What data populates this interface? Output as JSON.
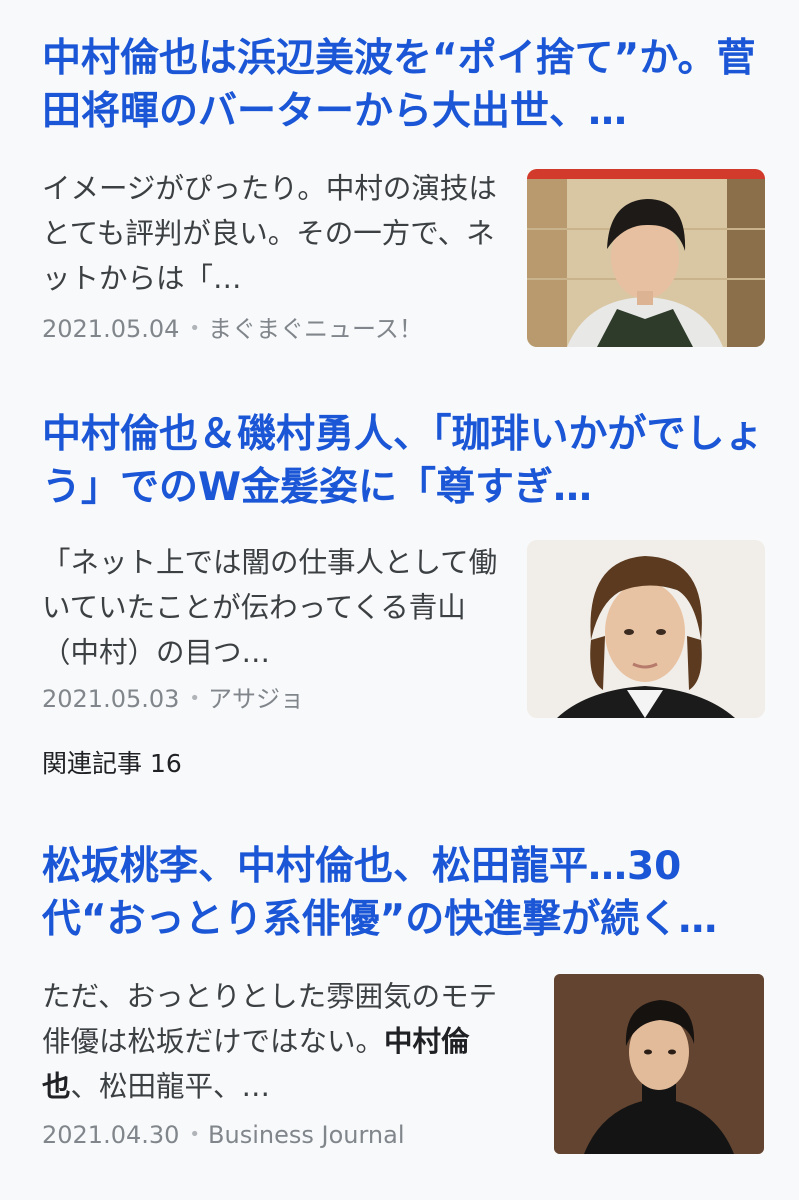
{
  "articles": [
    {
      "headline": "中村倫也は浜辺美波を“ポイ捨て”か。菅田将暉のバーターから大出世、…",
      "snippet": "イメージがぴったり。中村の演技はとても評判が良い。その一方で、ネットからは「…",
      "date": "2021.05.04",
      "source": "まぐまぐニュース！",
      "thumbnail": "portrait-man-dark-hair-office"
    },
    {
      "headline": "中村倫也＆磯村勇人、「珈琲いかがでしょう」でのW金髪姿に「尊すぎ…",
      "snippet": "「ネット上では闇の仕事人として働いていたことが伝わってくる青山（中村）の目つ…",
      "date": "2021.05.03",
      "source": "アサジョ",
      "thumbnail": "portrait-man-wavy-hair"
    },
    {
      "headline": "松坂桃李、中村倫也、松田龍平…30代“おっとり系俳優”の快進撃が続く…",
      "snippet_pre": "ただ、おっとりとした雰囲気のモテ俳優は松坂だけではない。",
      "snippet_bold": "中村倫也",
      "snippet_post": "、松田龍平、…",
      "date": "2021.04.30",
      "source": "Business Journal",
      "thumbnail": "portrait-man-black-turtleneck"
    }
  ],
  "related": {
    "label": "関連記事 16"
  },
  "dot": "•",
  "colors": {
    "headline": "#1a56d6",
    "background": "#f8f9fa",
    "meta": "#80868b"
  }
}
